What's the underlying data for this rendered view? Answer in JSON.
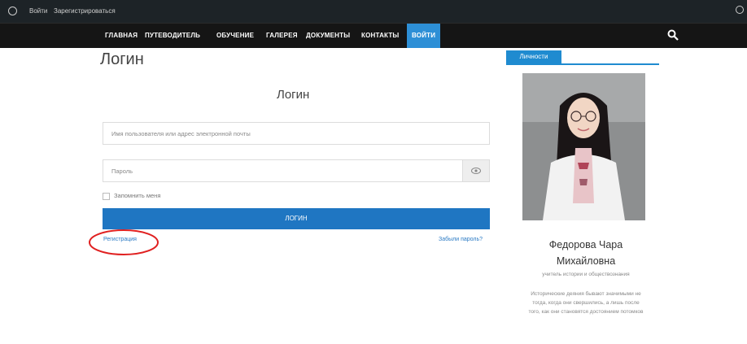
{
  "admin_bar": {
    "items": [
      "Войти",
      "Зарегистрироваться"
    ]
  },
  "nav": {
    "items": [
      "ГЛАВНАЯ",
      "ПУТЕВОДИТЕЛЬ",
      "ОБУЧЕНИЕ",
      "ГАЛЕРЕЯ",
      "ДОКУМЕНТЫ",
      "КОНТАКТЫ",
      "ВОЙТИ"
    ],
    "active_index": 6
  },
  "page": {
    "title": "Логин"
  },
  "login_form": {
    "title": "Логин",
    "username_placeholder": "Имя пользователя или адрес электронной почты",
    "password_placeholder": "Пароль",
    "remember_label": "Запомнить меня",
    "submit_label": "ЛОГИН",
    "register_link": "Регистрация",
    "forgot_link": "Забыли пароль?"
  },
  "sidebar": {
    "tab_label": "Личности",
    "person_name_line1": "Федорова Чара",
    "person_name_line2": "Михайловна",
    "person_role": "учитель истории и обществознания",
    "quote": "Исторические деяния бывают значимыми не тогда, когда они свершились, а лишь после того, как они становятся достоянием потомков"
  },
  "colors": {
    "accent": "#1f76c2",
    "nav_active": "#2d8fd6",
    "annotation": "#e02020"
  }
}
